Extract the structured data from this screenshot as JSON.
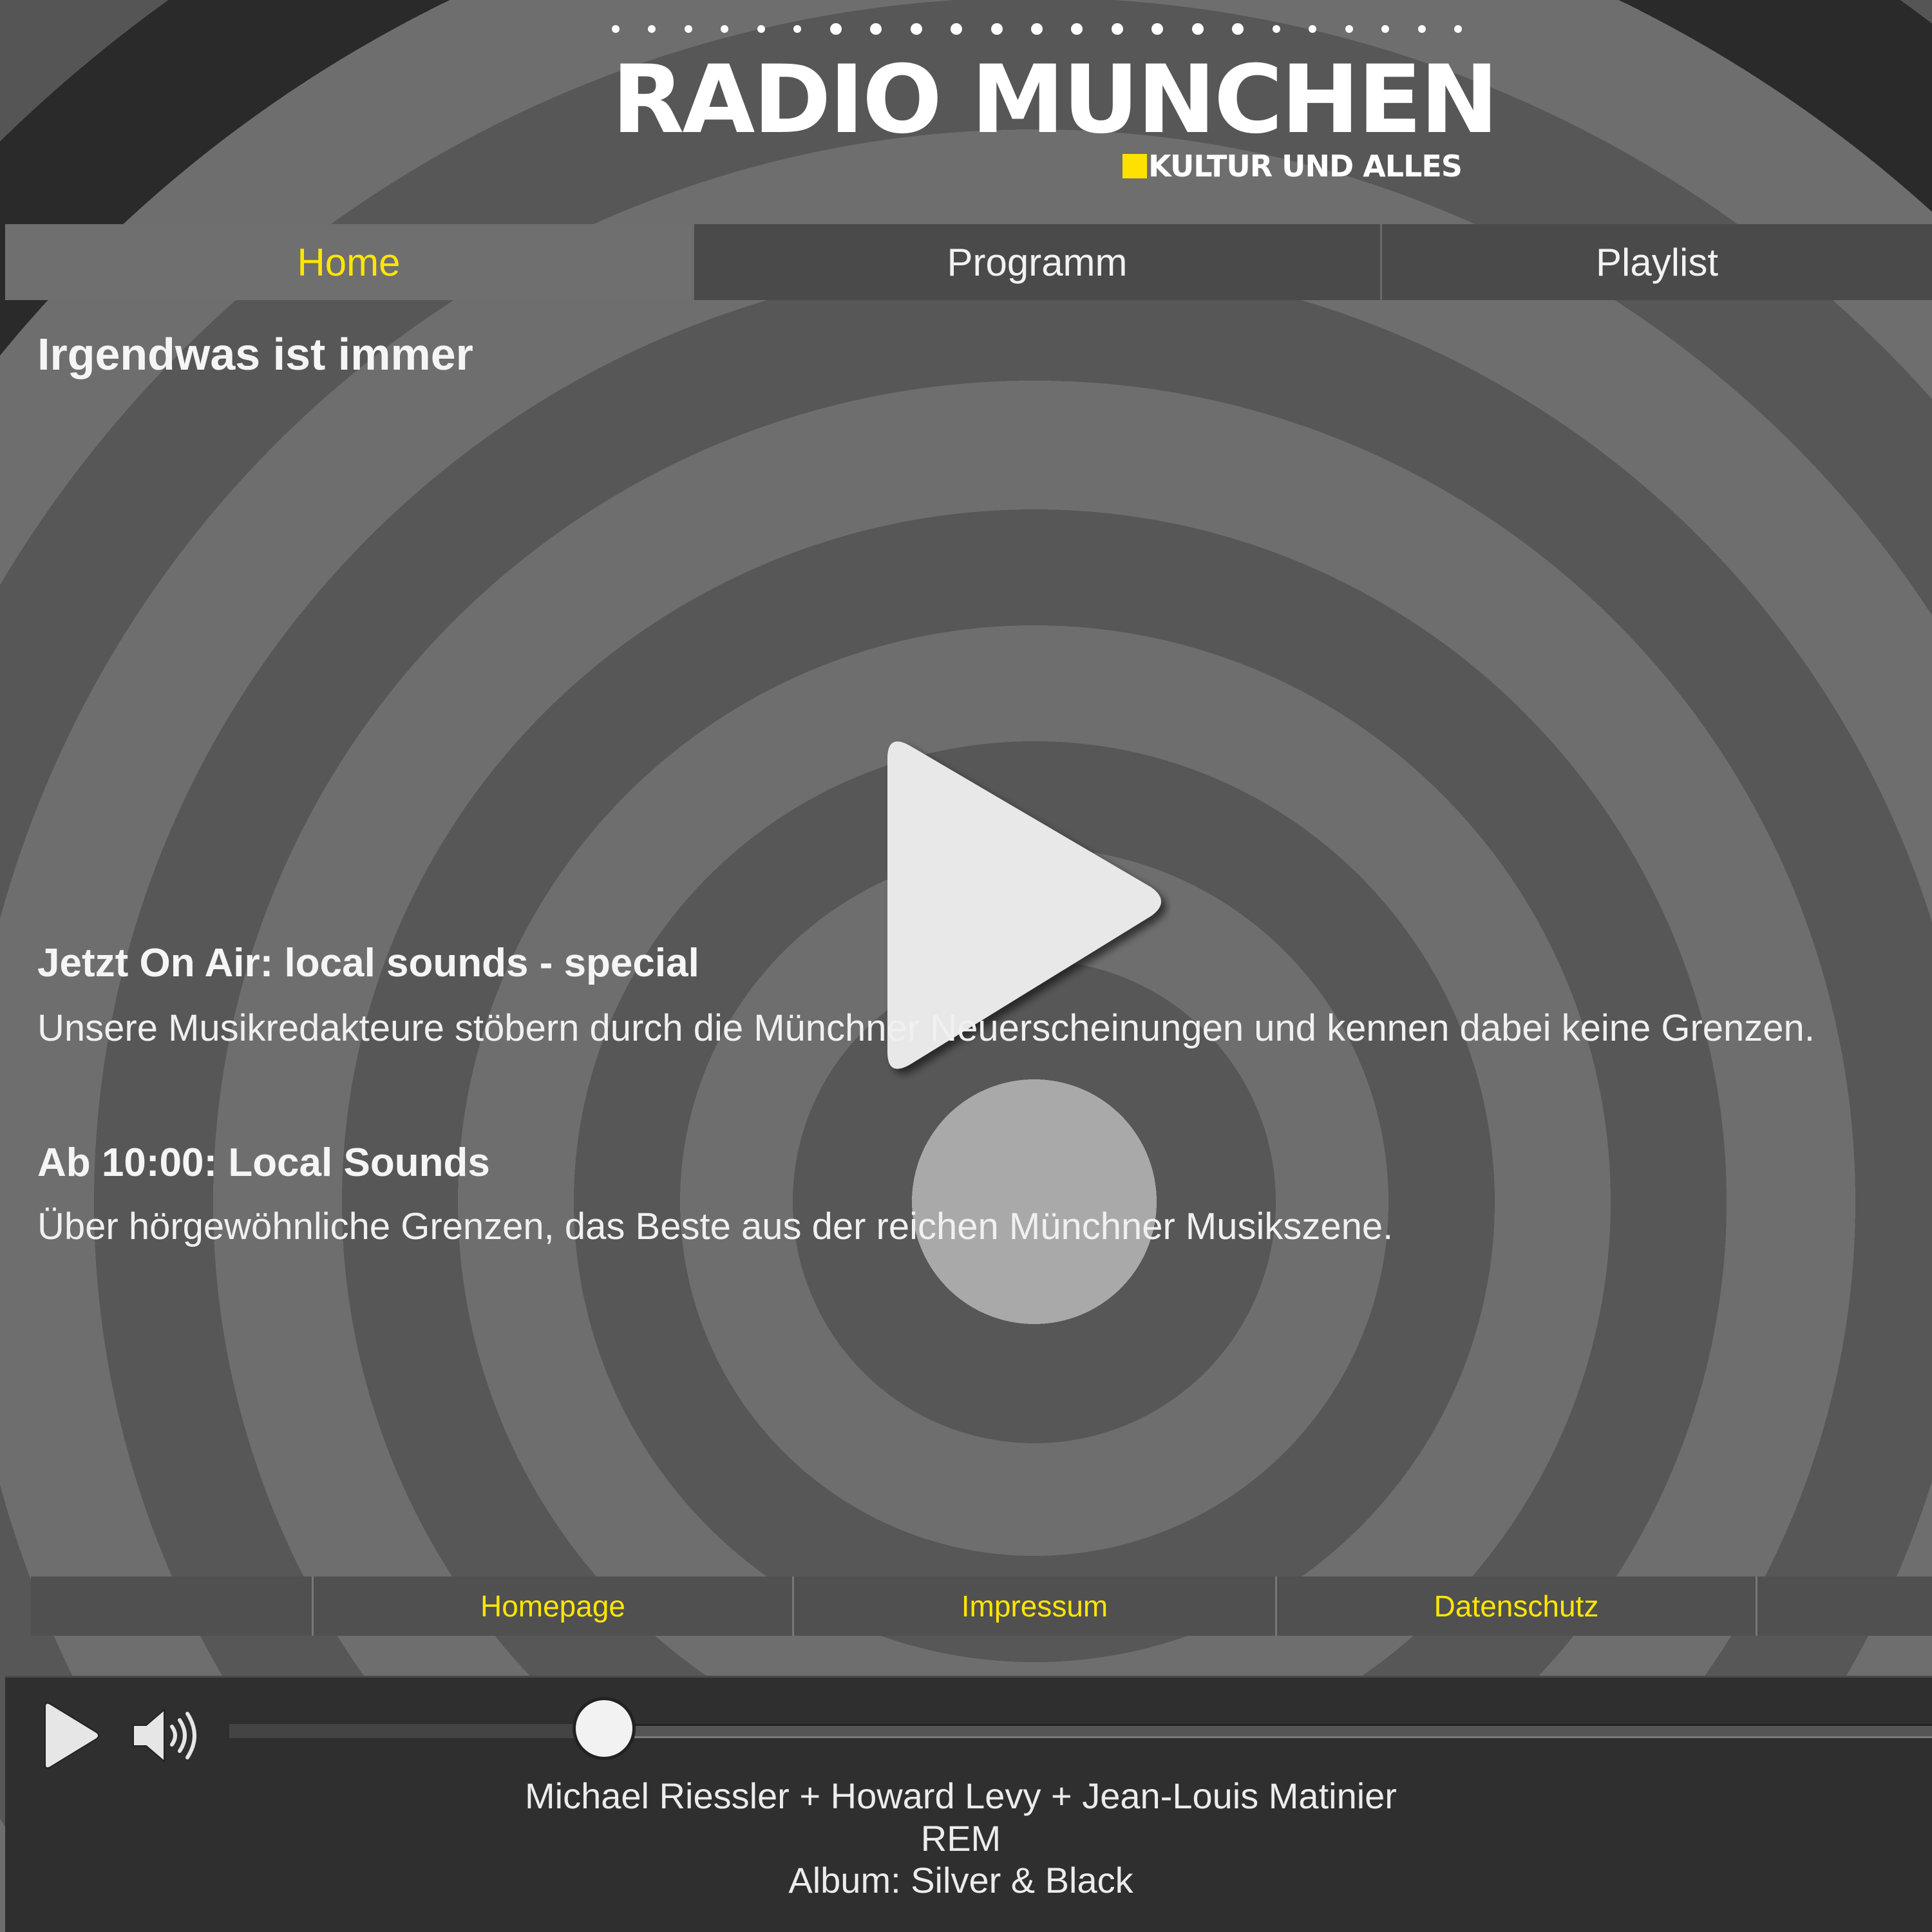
{
  "logo": {
    "title": "RADIO MUNCHEN",
    "subtitle": "KULTUR UND ALLES",
    "accent_color": "#ffe100"
  },
  "nav": {
    "tabs": [
      {
        "label": "Home",
        "active": true
      },
      {
        "label": "Programm",
        "active": false
      },
      {
        "label": "Playlist",
        "active": false
      }
    ]
  },
  "page": {
    "title": "Irgendwas ist immer"
  },
  "player_main": {
    "icon": "play-icon"
  },
  "shows": {
    "now": {
      "title": "Jetzt On Air: local sounds - special",
      "description": "Unsere Musikredakteure stöbern durch die Münchner Neuerscheinungen und kennen dabei keine Grenzen."
    },
    "next": {
      "title": "Ab 10:00: Local Sounds",
      "description": "Über hörgewöhnliche Grenzen, das Beste aus der reichen Münchner Musikszene."
    }
  },
  "footer": {
    "links": [
      {
        "label": "Homepage"
      },
      {
        "label": "Impressum"
      },
      {
        "label": "Datenschutz"
      }
    ],
    "link_color": "#ffe600"
  },
  "audio_player": {
    "play_icon": "play-icon",
    "volume_icon": "volume-icon",
    "progress": 0.22,
    "now_playing": {
      "artist": "Michael Riessler + Howard Levy + Jean-Louis Matinier",
      "title": "REM",
      "album": "Album: Silver & Black"
    }
  },
  "colors": {
    "active_tab": "#ffe600",
    "text": "#f5f5f5"
  }
}
